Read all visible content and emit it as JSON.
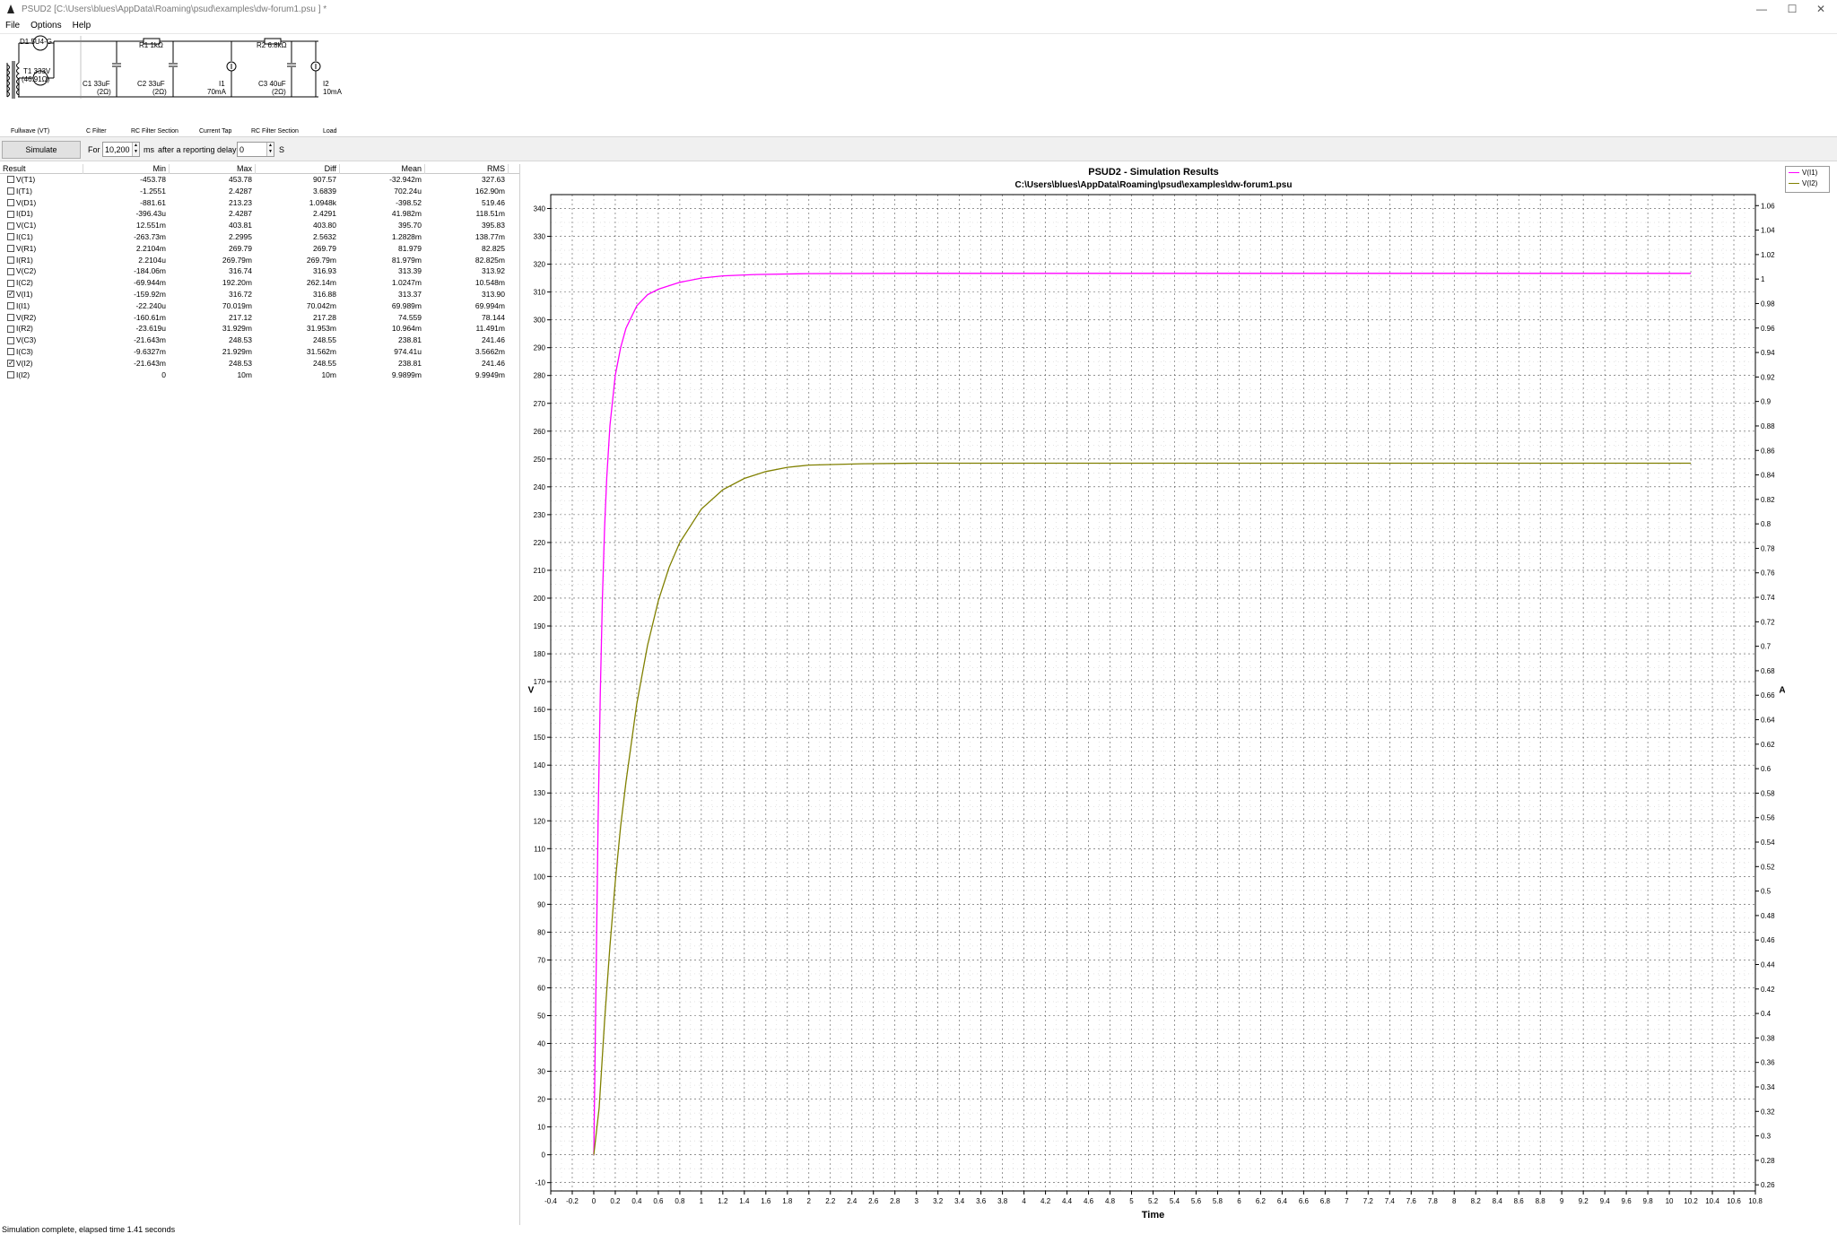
{
  "window": {
    "title": "PSUD2  [C:\\Users\\blues\\AppData\\Roaming\\psud\\examples\\dw-forum1.psu ] *",
    "minimize": "—",
    "maximize": "☐",
    "close": "✕"
  },
  "menu": [
    "File",
    "Options",
    "Help"
  ],
  "schematic": {
    "d1": "D1 5U4-G",
    "t1_name": "T1 333V",
    "t1_value": "(46.91Ω)",
    "r1": "R1 1kΩ",
    "r2": "R2 6.8kΩ",
    "c1_name": "C1 33uF",
    "c1_res": "(2Ω)",
    "c2_name": "C2 33uF",
    "c2_res": "(2Ω)",
    "i1_name": "I1",
    "i1_value": "70mA",
    "c3_name": "C3 40uF",
    "c3_res": "(2Ω)",
    "i2_name": "I2",
    "i2_value": "10mA",
    "sections": [
      "Fullwave (VT)",
      "C Filter",
      "RC Filter Section",
      "Current Tap",
      "RC Filter Section",
      "Load"
    ]
  },
  "toolbar": {
    "simulate": "Simulate",
    "for_label": "For",
    "duration": "10,200",
    "ms_label": "ms",
    "after_label": "after a reporting delay of",
    "delay": "0",
    "s_label": "S"
  },
  "table": {
    "headers": [
      "Result",
      "Min",
      "Max",
      "Diff",
      "Mean",
      "RMS"
    ],
    "rows": [
      {
        "name": "V(T1)",
        "checked": false,
        "min": "-453.78",
        "max": "453.78",
        "diff": "907.57",
        "mean": "-32.942m",
        "rms": "327.63"
      },
      {
        "name": "I(T1)",
        "checked": false,
        "min": "-1.2551",
        "max": "2.4287",
        "diff": "3.6839",
        "mean": "702.24u",
        "rms": "162.90m"
      },
      {
        "name": "V(D1)",
        "checked": false,
        "min": "-881.61",
        "max": "213.23",
        "diff": "1.0948k",
        "mean": "-398.52",
        "rms": "519.46"
      },
      {
        "name": "I(D1)",
        "checked": false,
        "min": "-396.43u",
        "max": "2.4287",
        "diff": "2.4291",
        "mean": "41.982m",
        "rms": "118.51m"
      },
      {
        "name": "V(C1)",
        "checked": false,
        "min": "12.551m",
        "max": "403.81",
        "diff": "403.80",
        "mean": "395.70",
        "rms": "395.83"
      },
      {
        "name": "I(C1)",
        "checked": false,
        "min": "-263.73m",
        "max": "2.2995",
        "diff": "2.5632",
        "mean": "1.2828m",
        "rms": "138.77m"
      },
      {
        "name": "V(R1)",
        "checked": false,
        "min": "2.2104m",
        "max": "269.79",
        "diff": "269.79",
        "mean": "81.979",
        "rms": "82.825"
      },
      {
        "name": "I(R1)",
        "checked": false,
        "min": "2.2104u",
        "max": "269.79m",
        "diff": "269.79m",
        "mean": "81.979m",
        "rms": "82.825m"
      },
      {
        "name": "V(C2)",
        "checked": false,
        "min": "-184.06m",
        "max": "316.74",
        "diff": "316.93",
        "mean": "313.39",
        "rms": "313.92"
      },
      {
        "name": "I(C2)",
        "checked": false,
        "min": "-69.944m",
        "max": "192.20m",
        "diff": "262.14m",
        "mean": "1.0247m",
        "rms": "10.548m"
      },
      {
        "name": "V(I1)",
        "checked": true,
        "min": "-159.92m",
        "max": "316.72",
        "diff": "316.88",
        "mean": "313.37",
        "rms": "313.90"
      },
      {
        "name": "I(I1)",
        "checked": false,
        "min": "-22.240u",
        "max": "70.019m",
        "diff": "70.042m",
        "mean": "69.989m",
        "rms": "69.994m"
      },
      {
        "name": "V(R2)",
        "checked": false,
        "min": "-160.61m",
        "max": "217.12",
        "diff": "217.28",
        "mean": "74.559",
        "rms": "78.144"
      },
      {
        "name": "I(R2)",
        "checked": false,
        "min": "-23.619u",
        "max": "31.929m",
        "diff": "31.953m",
        "mean": "10.964m",
        "rms": "11.491m"
      },
      {
        "name": "V(C3)",
        "checked": false,
        "min": "-21.643m",
        "max": "248.53",
        "diff": "248.55",
        "mean": "238.81",
        "rms": "241.46"
      },
      {
        "name": "I(C3)",
        "checked": false,
        "min": "-9.6327m",
        "max": "21.929m",
        "diff": "31.562m",
        "mean": "974.41u",
        "rms": "3.5662m"
      },
      {
        "name": "V(I2)",
        "checked": true,
        "min": "-21.643m",
        "max": "248.53",
        "diff": "248.55",
        "mean": "238.81",
        "rms": "241.46"
      },
      {
        "name": "I(I2)",
        "checked": false,
        "min": "0",
        "max": "10m",
        "diff": "10m",
        "mean": "9.9899m",
        "rms": "9.9949m"
      }
    ]
  },
  "chart_data": {
    "type": "line",
    "title": "PSUD2 - Simulation Results",
    "subtitle": "C:\\Users\\blues\\AppData\\Roaming\\psud\\examples\\dw-forum1.psu",
    "xlabel": "Time",
    "ylabel": "V",
    "y2label": "A",
    "xlim": [
      -0.4,
      10.8
    ],
    "ylim": [
      -13,
      345
    ],
    "y2lim": [
      0.255,
      1.069
    ],
    "xticks": [
      -0.4,
      -0.2,
      0,
      0.2,
      0.4,
      0.6,
      0.8,
      1,
      1.2,
      1.4,
      1.6,
      1.8,
      2,
      2.2,
      2.4,
      2.6,
      2.8,
      3,
      3.2,
      3.4,
      3.6,
      3.8,
      4,
      4.2,
      4.4,
      4.6,
      4.8,
      5,
      5.2,
      5.4,
      5.6,
      5.8,
      6,
      6.2,
      6.4,
      6.6,
      6.8,
      7,
      7.2,
      7.4,
      7.6,
      7.8,
      8,
      8.2,
      8.4,
      8.6,
      8.8,
      9,
      9.2,
      9.4,
      9.6,
      9.8,
      10,
      10.2,
      10.4,
      10.6,
      10.8
    ],
    "yticks": [
      -10,
      0,
      10,
      20,
      30,
      40,
      50,
      60,
      70,
      80,
      90,
      100,
      110,
      120,
      130,
      140,
      150,
      160,
      170,
      180,
      190,
      200,
      210,
      220,
      230,
      240,
      250,
      260,
      270,
      280,
      290,
      300,
      310,
      320,
      330,
      340
    ],
    "y2ticks": [
      0.26,
      0.28,
      0.3,
      0.32,
      0.34,
      0.36,
      0.38,
      0.4,
      0.42,
      0.44,
      0.46,
      0.48,
      0.5,
      0.52,
      0.54,
      0.56,
      0.58,
      0.6,
      0.62,
      0.64,
      0.66,
      0.68,
      0.7,
      0.72,
      0.74,
      0.76,
      0.78,
      0.8,
      0.82,
      0.84,
      0.86,
      0.88,
      0.9,
      0.92,
      0.94,
      0.96,
      0.98,
      1,
      1.02,
      1.04,
      1.06
    ],
    "grid": true,
    "legend_position": "outside-top-right",
    "series": [
      {
        "name": "V(I1)",
        "color": "#ff00ff",
        "x": [
          0,
          0.02,
          0.04,
          0.06,
          0.08,
          0.1,
          0.12,
          0.15,
          0.2,
          0.25,
          0.3,
          0.4,
          0.5,
          0.6,
          0.8,
          1.0,
          1.2,
          1.5,
          2.0,
          3.0,
          5.0,
          7.0,
          10.2
        ],
        "y": [
          0,
          60,
          120,
          165,
          200,
          225,
          243,
          262,
          280,
          290,
          297,
          305,
          309,
          311,
          313.5,
          315,
          315.8,
          316.3,
          316.6,
          316.7,
          316.7,
          316.7,
          316.7
        ]
      },
      {
        "name": "V(I2)",
        "color": "#808000",
        "x": [
          0,
          0.05,
          0.1,
          0.15,
          0.2,
          0.25,
          0.3,
          0.4,
          0.5,
          0.6,
          0.7,
          0.8,
          1.0,
          1.2,
          1.4,
          1.6,
          1.8,
          2.0,
          2.5,
          3.0,
          4.0,
          6.0,
          10.2
        ],
        "y": [
          0,
          17,
          48,
          75,
          98,
          118,
          134,
          162,
          183,
          199,
          211,
          220,
          232,
          239,
          243,
          245.5,
          247,
          247.8,
          248.3,
          248.5,
          248.5,
          248.5,
          248.5
        ]
      }
    ]
  },
  "status": "Simulation complete, elapsed time 1.41 seconds"
}
